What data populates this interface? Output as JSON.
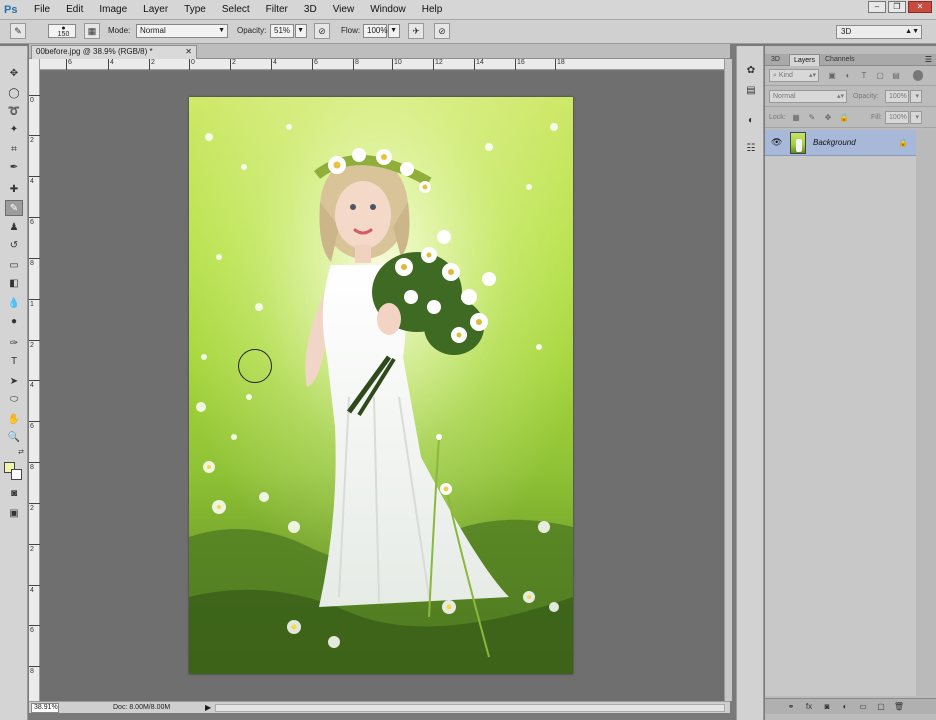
{
  "app": {
    "logo": "Ps"
  },
  "menu": [
    "File",
    "Edit",
    "Image",
    "Layer",
    "Type",
    "Select",
    "Filter",
    "3D",
    "View",
    "Window",
    "Help"
  ],
  "workspace": "3D",
  "options": {
    "brush_size": "150",
    "mode_label": "Mode:",
    "mode_value": "Normal",
    "opacity_label": "Opacity:",
    "opacity_value": "51%",
    "flow_label": "Flow:",
    "flow_value": "100%"
  },
  "document": {
    "tab_title": "00before.jpg @ 38.9% (RGB/8) *",
    "ruler_h": [
      "6",
      "4",
      "2",
      "0",
      "2",
      "4",
      "6",
      "8",
      "10",
      "12",
      "14",
      "16",
      "18"
    ],
    "ruler_v": [
      "0",
      "2",
      "4",
      "6",
      "8",
      "1",
      "2",
      "4",
      "6",
      "8",
      "2",
      "2",
      "4",
      "6",
      "8",
      "3",
      "2"
    ]
  },
  "status": {
    "zoom": "38.91%",
    "doc_size": "Doc: 8.00M/8.00M"
  },
  "layers_panel": {
    "tabs": [
      "3D",
      "Layers",
      "Channels"
    ],
    "filter_label": "Kind",
    "blend_mode": "Normal",
    "opacity_label": "Opacity:",
    "opacity_value": "100%",
    "lock_label": "Lock:",
    "fill_label": "Fill:",
    "fill_value": "100%",
    "layer_name": "Background"
  },
  "colors": {
    "foreground": "#f1f3b0",
    "background": "#ffffff",
    "selection": "#a8b8d8"
  }
}
